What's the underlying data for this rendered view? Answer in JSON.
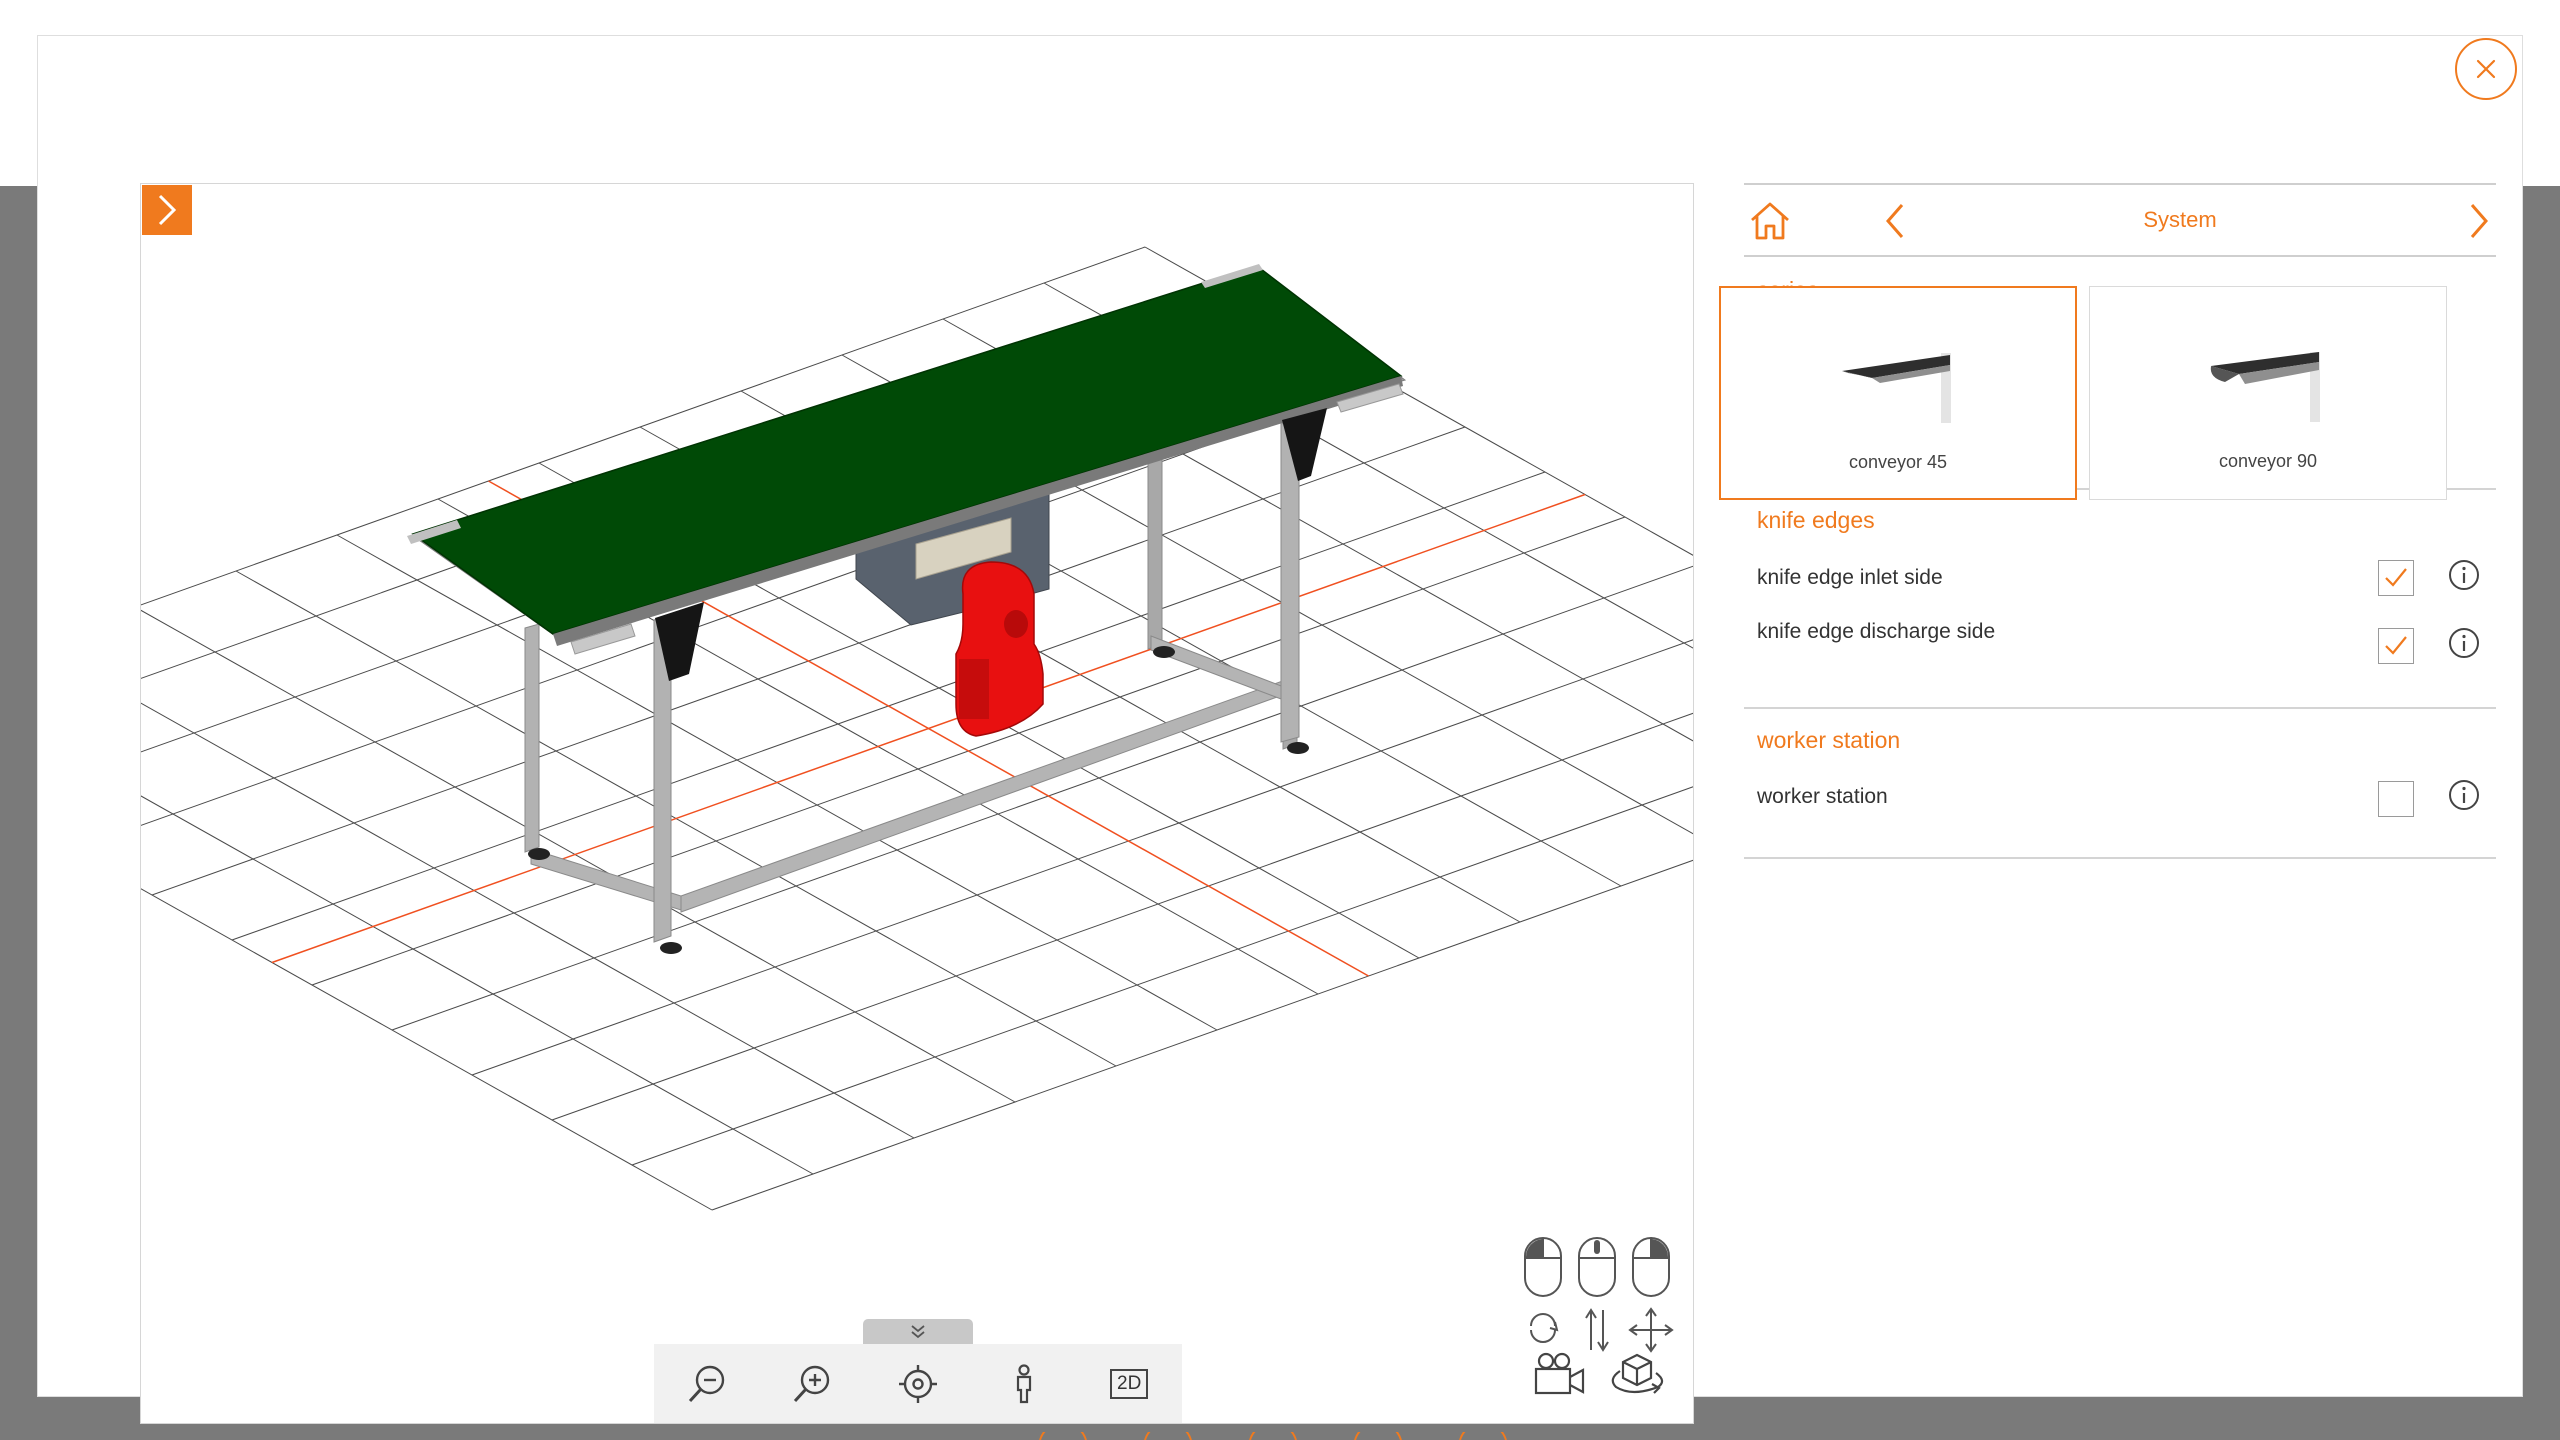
{
  "panel": {
    "nav_title": "System",
    "series": {
      "title": "series",
      "options": [
        {
          "label": "conveyor 45",
          "selected": true
        },
        {
          "label": "conveyor 90",
          "selected": false
        }
      ]
    },
    "knife_edges": {
      "title": "knife edges",
      "options": [
        {
          "label": "knife edge inlet side",
          "checked": true
        },
        {
          "label": "knife edge discharge side",
          "checked": true
        }
      ]
    },
    "worker_station": {
      "title": "worker station",
      "options": [
        {
          "label": "worker station",
          "checked": false
        }
      ]
    }
  },
  "viewer": {
    "toolbar": {
      "mode_label": "2D",
      "tools": [
        "zoom-out-icon",
        "zoom-in-icon",
        "center-target-icon",
        "person-icon",
        "2d-view-button"
      ]
    },
    "mouse_help": [
      "rotate",
      "zoom",
      "pan"
    ]
  },
  "colors": {
    "accent": "#f07a1e",
    "belt": "#004a06",
    "motor": "#e81010",
    "frame": "#9a9a9a",
    "grid": "#4a4a4a",
    "axis": "#f05020"
  }
}
